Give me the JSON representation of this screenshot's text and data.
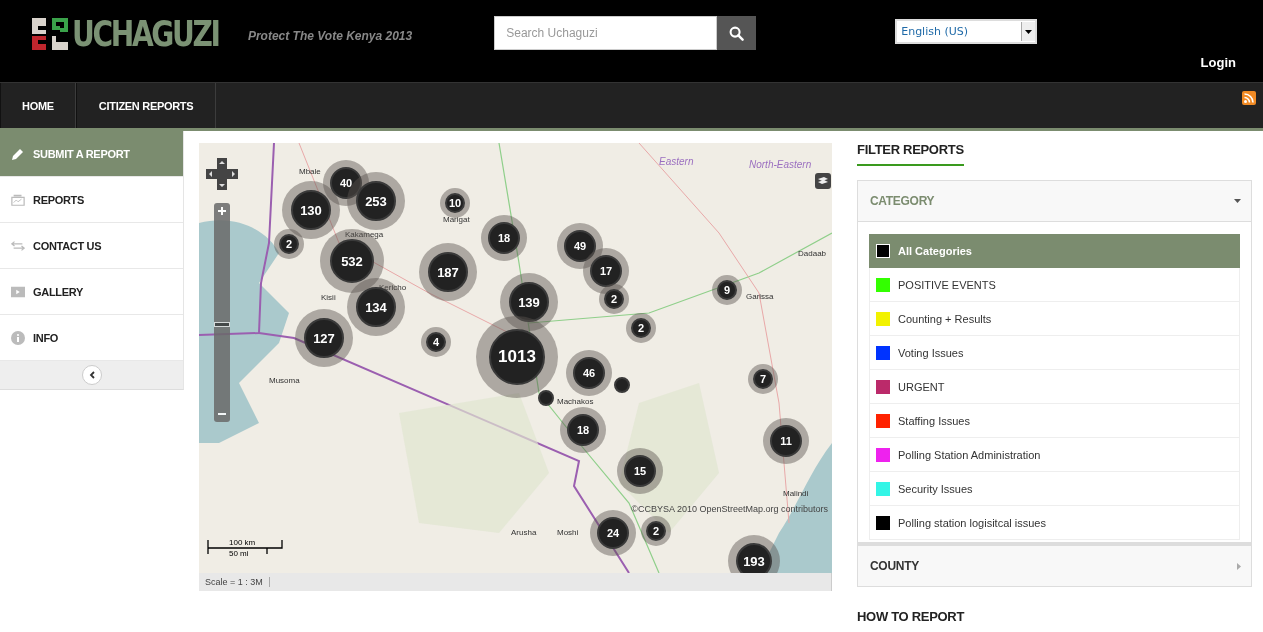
{
  "header": {
    "logo": "UCHAGUZI",
    "tagline": "Protect The Vote Kenya 2013",
    "search": {
      "placeholder": "Search Uchaguzi"
    },
    "language": "English (US)",
    "login": "Login"
  },
  "nav": [
    {
      "label": "HOME"
    },
    {
      "label": "CITIZEN REPORTS"
    }
  ],
  "sidebar": {
    "items": [
      {
        "label": "SUBMIT A REPORT",
        "selected": true,
        "kind": "pencil"
      },
      {
        "label": "REPORTS",
        "selected": false,
        "kind": "reports"
      },
      {
        "label": "CONTACT US",
        "selected": false,
        "kind": "arrows"
      },
      {
        "label": "GALLERY",
        "selected": false,
        "kind": "film"
      },
      {
        "label": "INFO",
        "selected": false,
        "kind": "info"
      }
    ]
  },
  "map": {
    "places": [
      {
        "label": "Eastern",
        "kind": "region"
      },
      {
        "label": "North-Eastern",
        "kind": "region"
      },
      {
        "label": "Mbale",
        "kind": "town"
      },
      {
        "label": "Kakamega",
        "kind": "town"
      },
      {
        "label": "Marigat",
        "kind": "town"
      },
      {
        "label": "Kericho",
        "kind": "town"
      },
      {
        "label": "Kisii",
        "kind": "town"
      },
      {
        "label": "Musoma",
        "kind": "town"
      },
      {
        "label": "Dadaab",
        "kind": "town"
      },
      {
        "label": "Garissa",
        "kind": "town"
      },
      {
        "label": "Machakos",
        "kind": "town"
      },
      {
        "label": "Arusha",
        "kind": "town"
      },
      {
        "label": "Moshi",
        "kind": "town"
      },
      {
        "label": "Malindi",
        "kind": "town"
      }
    ],
    "clusters": [
      {
        "kind": "cluster",
        "count": "130"
      },
      {
        "kind": "cluster",
        "count": "40"
      },
      {
        "kind": "cluster",
        "count": "253"
      },
      {
        "kind": "cluster",
        "count": "10"
      },
      {
        "kind": "cluster",
        "count": "2"
      },
      {
        "kind": "cluster",
        "count": "532"
      },
      {
        "kind": "cluster",
        "count": "18"
      },
      {
        "kind": "cluster",
        "count": "49"
      },
      {
        "kind": "cluster",
        "count": "187"
      },
      {
        "kind": "cluster",
        "count": "17"
      },
      {
        "kind": "cluster",
        "count": "139"
      },
      {
        "kind": "cluster",
        "count": "2"
      },
      {
        "kind": "cluster",
        "count": "9"
      },
      {
        "kind": "cluster",
        "count": "134"
      },
      {
        "kind": "cluster",
        "count": "2"
      },
      {
        "kind": "cluster",
        "count": "127"
      },
      {
        "kind": "cluster",
        "count": "4"
      },
      {
        "kind": "cluster",
        "count": "1013"
      },
      {
        "kind": "cluster",
        "count": "46"
      },
      {
        "kind": "point"
      },
      {
        "kind": "point"
      },
      {
        "kind": "cluster",
        "count": "7"
      },
      {
        "kind": "cluster",
        "count": "11"
      },
      {
        "kind": "cluster",
        "count": "18"
      },
      {
        "kind": "cluster",
        "count": "15"
      },
      {
        "kind": "cluster",
        "count": "24"
      },
      {
        "kind": "cluster",
        "count": "2"
      },
      {
        "kind": "cluster",
        "count": "193"
      }
    ],
    "zoom": {
      "level": 0.42
    },
    "scale_km": "100 km",
    "scale_mi": "50 mi",
    "scale": "Scale = 1 : 3M",
    "attribution": "©CCBYSA 2010 OpenStreetMap.org contributors"
  },
  "filter": {
    "title": "FILTER REPORTS",
    "sections": [
      {
        "title": "CATEGORY",
        "expanded": true,
        "categories": [
          {
            "label": "All Categories",
            "color": "#000000",
            "selected": true
          },
          {
            "label": "POSITIVE EVENTS",
            "color": "#33ff00",
            "selected": false
          },
          {
            "label": "Counting + Results",
            "color": "#f2f200",
            "selected": false
          },
          {
            "label": "Voting Issues",
            "color": "#0033ff",
            "selected": false
          },
          {
            "label": "URGENT",
            "color": "#bb2a6a",
            "selected": false
          },
          {
            "label": "Staffing Issues",
            "color": "#ff2200",
            "selected": false
          },
          {
            "label": "Polling Station Administration",
            "color": "#ee22ee",
            "selected": false
          },
          {
            "label": "Security Issues",
            "color": "#33f5e6",
            "selected": false
          },
          {
            "label": "Polling station logisitcal issues",
            "color": "#000000",
            "selected": false
          }
        ]
      },
      {
        "title": "COUNTY",
        "expanded": false
      }
    ]
  },
  "how_to_report": "HOW TO REPORT"
}
